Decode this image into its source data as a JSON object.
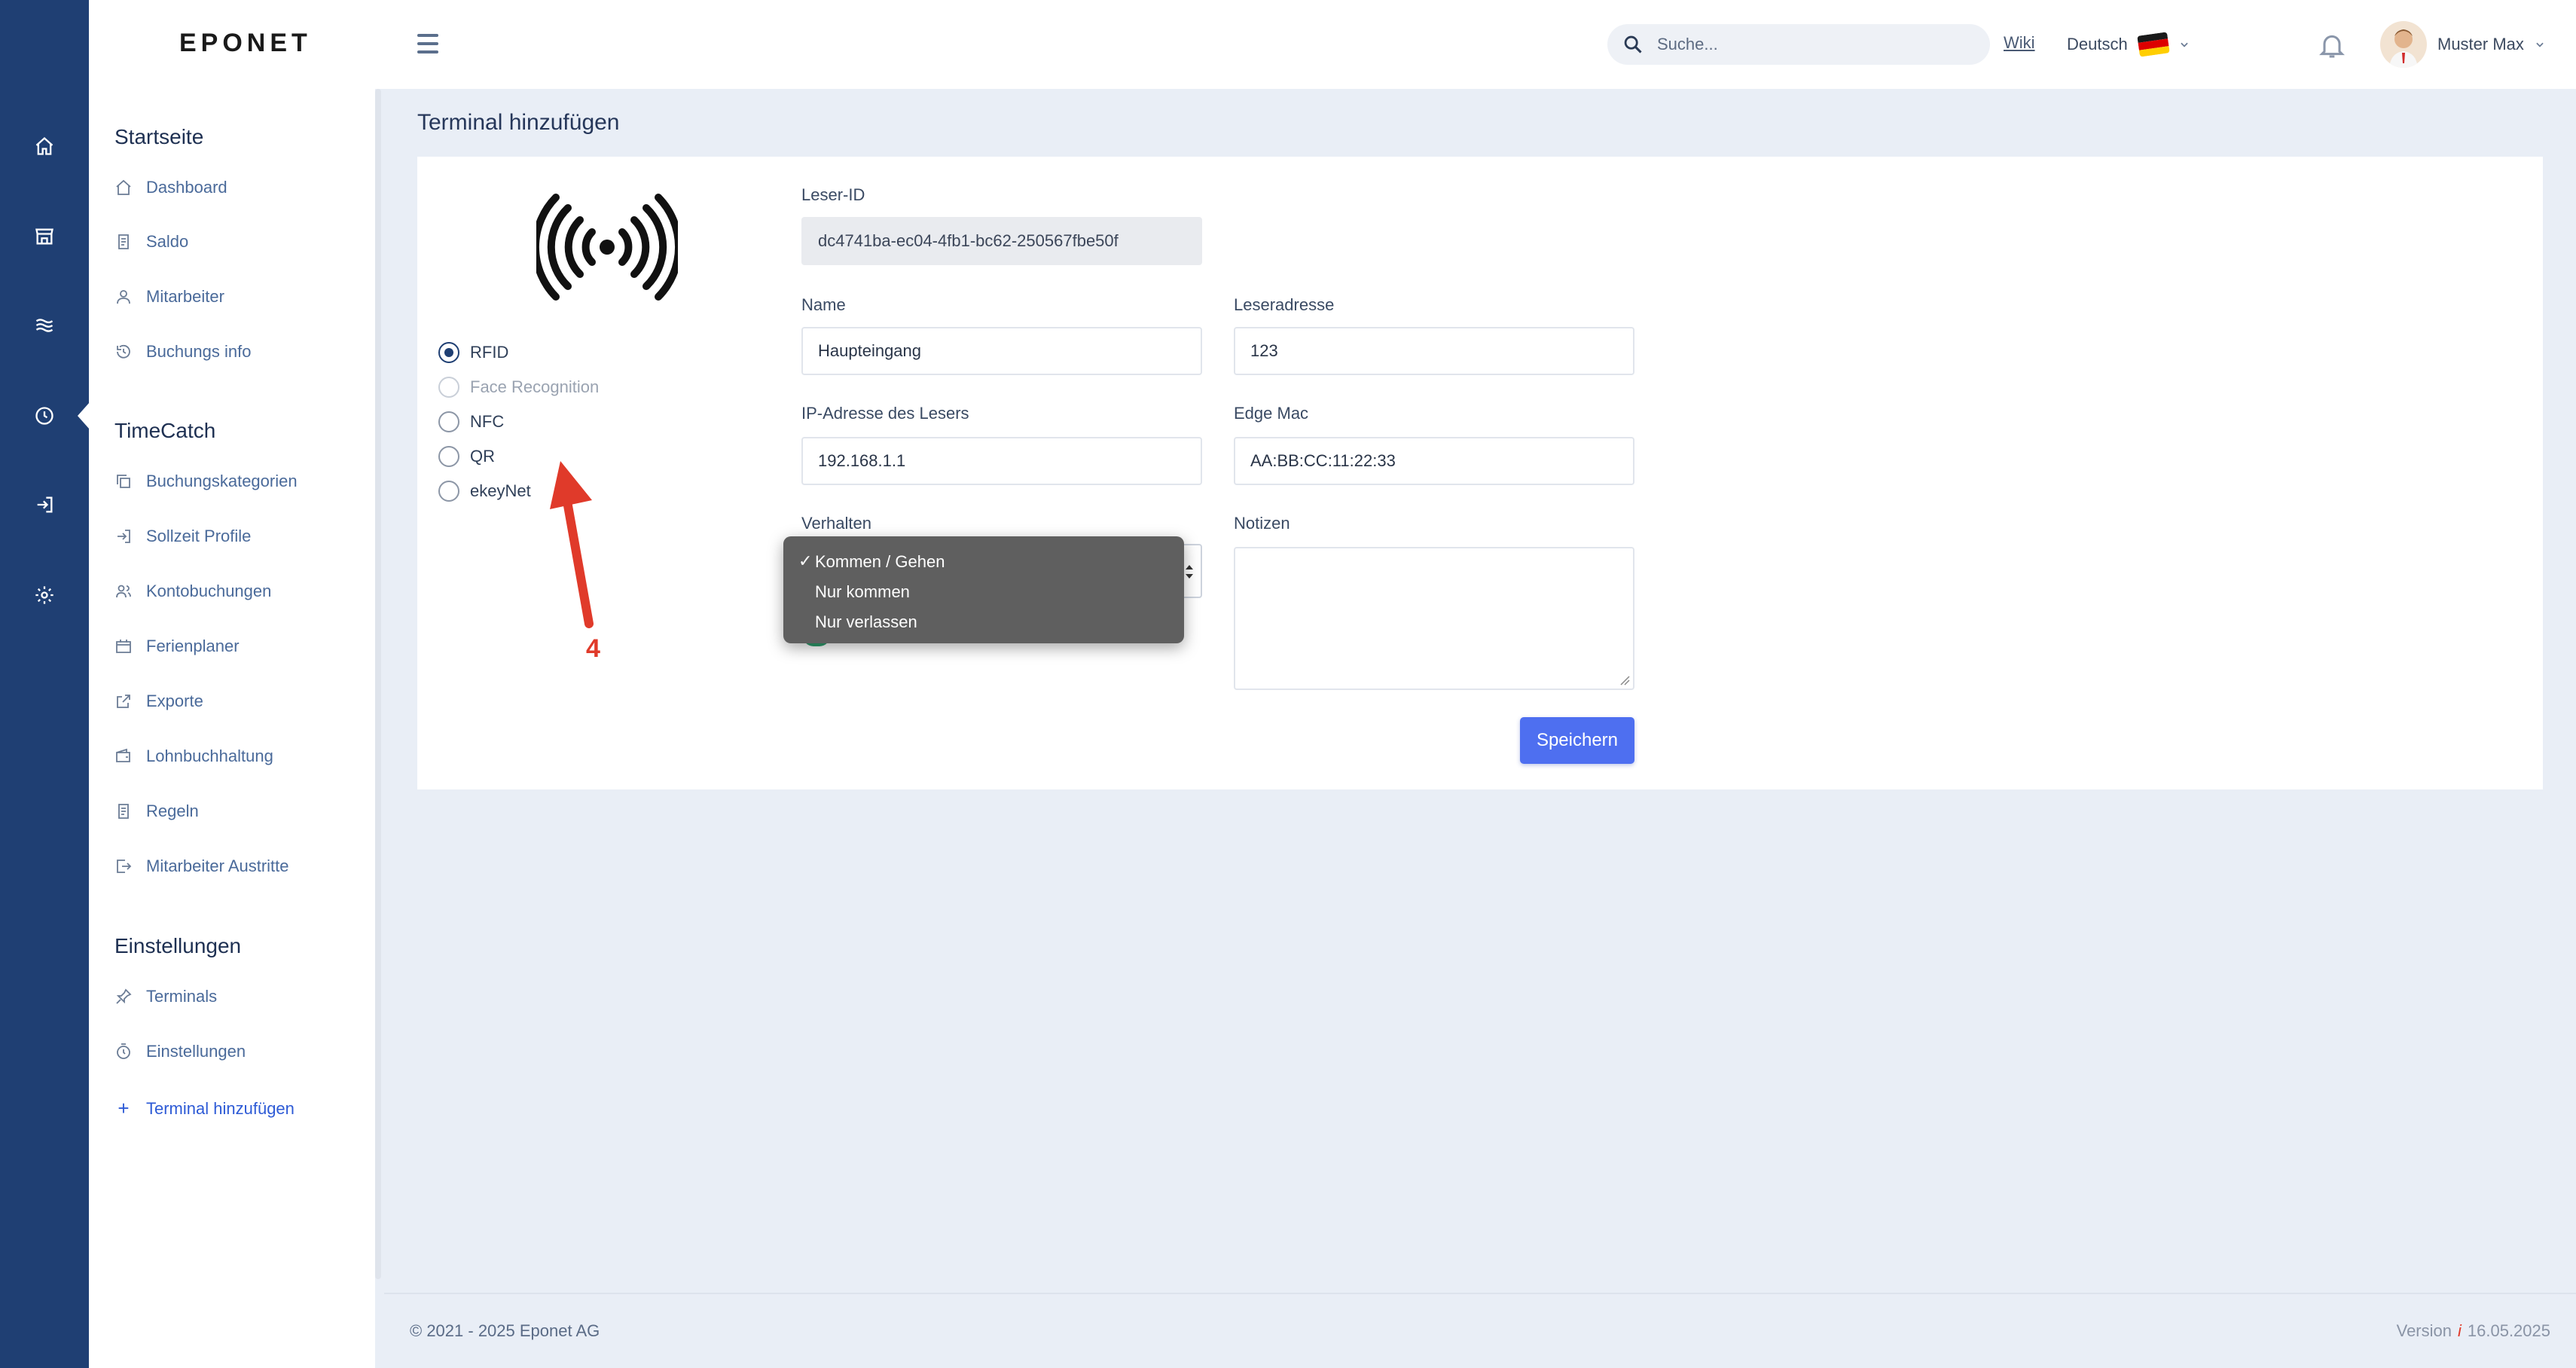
{
  "topbar": {
    "logo": "EPONET",
    "search_placeholder": "Suche...",
    "wiki": "Wiki",
    "language": "Deutsch",
    "flag_colors": [
      "#1a1a1a",
      "#dd0000",
      "#ffce00"
    ],
    "user_name": "Muster Max"
  },
  "rail": {
    "icons": [
      "home-icon",
      "store-icon",
      "waves-icon",
      "clock-icon",
      "login-icon",
      "gear-icon"
    ],
    "active": "clock-icon"
  },
  "sidebar": {
    "sections": [
      {
        "title": "Startseite",
        "items": [
          {
            "label": "Dashboard",
            "icon": "home-icon"
          },
          {
            "label": "Saldo",
            "icon": "document-icon"
          },
          {
            "label": "Mitarbeiter",
            "icon": "user-icon"
          },
          {
            "label": "Buchungs info",
            "icon": "history-icon"
          }
        ]
      },
      {
        "title": "TimeCatch",
        "items": [
          {
            "label": "Buchungskategorien",
            "icon": "copy-icon"
          },
          {
            "label": "Sollzeit Profile",
            "icon": "login-icon"
          },
          {
            "label": "Kontobuchungen",
            "icon": "users-icon"
          },
          {
            "label": "Ferienplaner",
            "icon": "calendar-icon"
          },
          {
            "label": "Exporte",
            "icon": "export-icon"
          },
          {
            "label": "Lohnbuchhaltung",
            "icon": "wallet-icon"
          },
          {
            "label": "Regeln",
            "icon": "document-icon"
          },
          {
            "label": "Mitarbeiter Austritte",
            "icon": "exit-icon"
          }
        ]
      },
      {
        "title": "Einstellungen",
        "items": [
          {
            "label": "Terminals",
            "icon": "pin-icon"
          },
          {
            "label": "Einstellungen",
            "icon": "timer-icon"
          },
          {
            "label": "Terminal hinzufügen",
            "icon": "plus-icon",
            "active": true
          }
        ]
      }
    ]
  },
  "main": {
    "title": "Terminal hinzufügen",
    "reader_types": [
      {
        "label": "RFID",
        "checked": true,
        "disabled": false
      },
      {
        "label": "Face Recognition",
        "checked": false,
        "disabled": true
      },
      {
        "label": "NFC",
        "checked": false,
        "disabled": false
      },
      {
        "label": "QR",
        "checked": false,
        "disabled": false
      },
      {
        "label": "ekeyNet",
        "checked": false,
        "disabled": false
      }
    ],
    "form": {
      "leser_id_label": "Leser-ID",
      "leser_id_value": "dc4741ba-ec04-4fb1-bc62-250567fbe50f",
      "name_label": "Name",
      "name_value": "Haupteingang",
      "leseradresse_label": "Leseradresse",
      "leseradresse_value": "123",
      "ip_label": "IP-Adresse des Lesers",
      "ip_value": "192.168.1.1",
      "edge_mac_label": "Edge Mac",
      "edge_mac_value": "AA:BB:CC:11:22:33",
      "verhalten_label": "Verhalten",
      "notizen_label": "Notizen",
      "notizen_value": "",
      "save_label": "Speichern"
    },
    "dropdown": {
      "options": [
        {
          "label": "Kommen / Gehen",
          "selected": true
        },
        {
          "label": "Nur kommen",
          "selected": false
        },
        {
          "label": "Nur verlassen",
          "selected": false
        }
      ],
      "check_mark": "✓"
    },
    "annotation": {
      "number": "4",
      "color": "#e03a2a"
    }
  },
  "footer": {
    "copyright": "© 2021 - 2025 Eponet AG",
    "version_label": "Version",
    "version_icon": "i",
    "version_date": "16.05.2025"
  }
}
